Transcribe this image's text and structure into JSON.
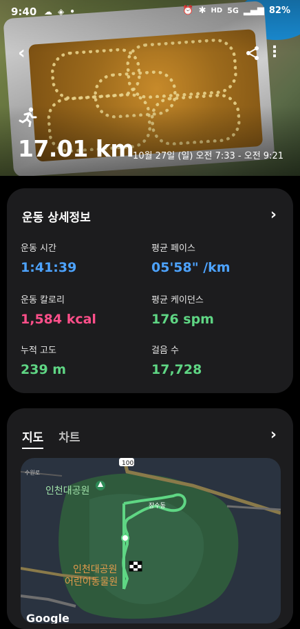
{
  "status": {
    "time": "9:40",
    "left_icons": [
      "cloud-icon",
      "map-marker-icon",
      "dot"
    ],
    "hd_label": "HD",
    "network": "5G",
    "battery": "82%"
  },
  "hero": {
    "distance": "17.01 km",
    "datetime": "10월 27일 (일) 오전 7:33 - 오전 9:21"
  },
  "details": {
    "title": "운동 상세정보",
    "stats": [
      {
        "label": "운동 시간",
        "value": "1:41:39",
        "color": "#4da3ff"
      },
      {
        "label": "평균 페이스",
        "value": "05'58\" /km",
        "color": "#4da3ff"
      },
      {
        "label": "운동 칼로리",
        "value": "1,584 kcal",
        "color": "#ff4f8a"
      },
      {
        "label": "평균 케이던스",
        "value": "176 spm",
        "color": "#5fd684"
      },
      {
        "label": "누적 고도",
        "value": "239 m",
        "color": "#5fd684"
      },
      {
        "label": "걸음 수",
        "value": "17,728",
        "color": "#5fd684"
      }
    ]
  },
  "map_card": {
    "tabs": [
      "지도",
      "차트"
    ],
    "active_tab": "지도",
    "labels": {
      "road_number": "100",
      "park_name": "인천대공원",
      "zoo_line1": "인천대공원",
      "zoo_line2": "어린이동물원",
      "area": "장수동",
      "dong_small": "수원로",
      "google": "Google"
    }
  }
}
